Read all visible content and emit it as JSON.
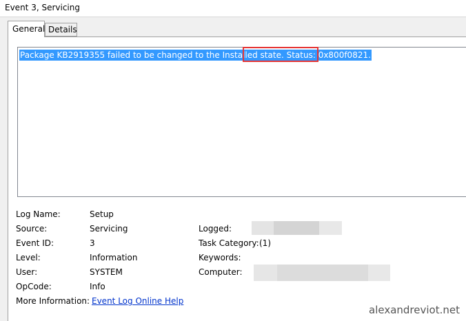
{
  "window": {
    "title": "Event 3, Servicing"
  },
  "tabs": [
    {
      "label": "General",
      "active": true
    },
    {
      "label": "Details",
      "active": false
    }
  ],
  "message": {
    "text_before": "Package KB2919355 failed to be changed to the Installed state.",
    "highlighted": "Status: 0x800f0821."
  },
  "fields": {
    "log_name": {
      "label": "Log Name:",
      "value": "Setup"
    },
    "source": {
      "label": "Source:",
      "value": "Servicing"
    },
    "event_id": {
      "label": "Event ID:",
      "value": "3"
    },
    "level": {
      "label": "Level:",
      "value": "Information"
    },
    "user": {
      "label": "User:",
      "value": "SYSTEM"
    },
    "opcode": {
      "label": "OpCode:",
      "value": "Info"
    },
    "more_info": {
      "label": "More Information:",
      "link": "Event Log Online Help"
    },
    "logged": {
      "label": "Logged:"
    },
    "task_category": {
      "label": "Task Category:",
      "value": "(1)"
    },
    "keywords": {
      "label": "Keywords:"
    },
    "computer": {
      "label": "Computer:"
    }
  },
  "watermark": "alexandreviot.net",
  "colors": {
    "selection": "#3399ff",
    "annotation_box": "#e53535",
    "link": "#0033cc"
  }
}
